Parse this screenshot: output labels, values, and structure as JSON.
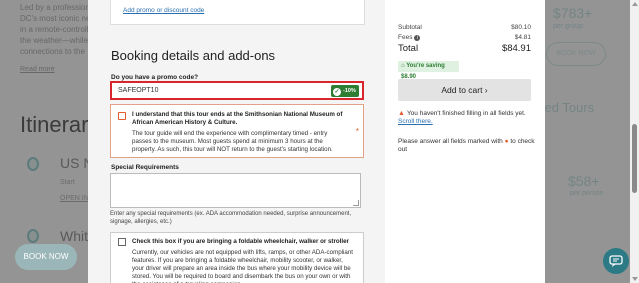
{
  "background": {
    "intro_lines": [
      "Led by a professional",
      "DC's most iconic ne",
      "in a remote-controll",
      "the weather—while",
      "connections to the"
    ],
    "read_more": "Read more",
    "itinerary_heading": "Itinerar",
    "stop1": "US Na",
    "start_label": "Start",
    "open_link": "OPEN IN",
    "stop2": "White",
    "book_now": "BOOK NOW",
    "price": "$783+",
    "per_group": "per group",
    "book_now_right": "BOOK NOW",
    "related_heading": "zed Tours",
    "related_price": "$58+",
    "related_per": "per person"
  },
  "modal": {
    "promo_link": "Add promo or discount code",
    "section_title": "Booking details and add-ons",
    "promo_question": "Do you have a promo code?",
    "promo_value": "SAFEOPT10",
    "promo_badge": "-10%",
    "notice_title": "I understand that this tour ends at the Smithsonian National Museum of African American History & Culture.",
    "notice_body": "The tour guide will end the experience with complimentary timed - entry passes to the museum. Most guests spend at minimum 3 hours at the property. As such, this tour will NOT return to the guest's starting location.",
    "special_label": "Special Requirements",
    "special_help": "Enter any special requirements (ex. ADA accommodation needed, surprise announcement, signage, allergies, etc.)",
    "wheelchair_title": "Check this box if you are bringing a foldable wheelchair, walker or stroller",
    "wheelchair_body": "Currently, our vehicles are not equipped with lifts, ramps, or other ADA-compliant features. If you are bringing a foldable wheelchair, mobility scooter, or walker, your driver will prepare an area inside the bus where your mobility device will be stored. You will be required to board and disembark the bus on your own or with the assistance of a traveling companion.",
    "summary": {
      "subtotal_label": "Subtotal",
      "subtotal_value": "$80.10",
      "fees_label": "Fees",
      "fees_value": "$4.81",
      "total_label": "Total",
      "total_value": "$84.91",
      "saving": "You're saving $8.90",
      "add_to_cart": "Add to cart ›",
      "warning_text": "You haven't finished filling in all fields yet.",
      "warning_link": "Scroll there.",
      "required_text_before": "Please answer all fields marked with",
      "required_text_after": "to check out"
    }
  },
  "colors": {
    "error": "#d9262c",
    "success": "#2e7d32",
    "link": "#2a6fb0",
    "warning": "#e45a2f"
  }
}
